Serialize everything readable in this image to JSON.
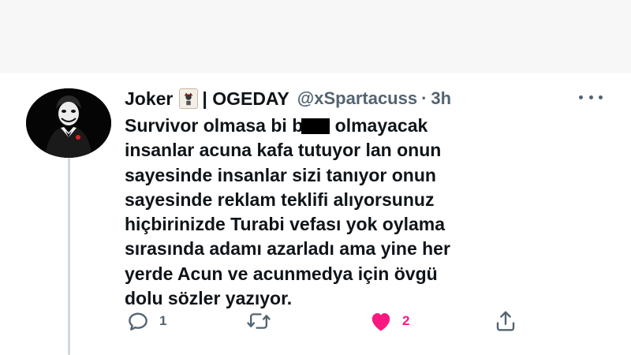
{
  "tweet": {
    "display_name": "Joker",
    "name_suffix": "| OGEDAY",
    "handle": "@xSpartacuss",
    "separator": "·",
    "time": "3h",
    "body_lines": [
      {
        "before": "Survivor olmasa bi b",
        "after": " olmayacak"
      },
      "insanlar acuna kafa tutuyor lan onun",
      "sayesinde insanlar sizi tanıyor onun",
      "sayesinde reklam teklifi alıyorsunuz",
      "hiçbirinizde Turabi vefası yok oylama",
      "sırasında adamı azarladı ama yine her",
      "yerde Acun ve acunmedya için övgü",
      "dolu sözler yazıyor."
    ]
  },
  "actions": {
    "reply": {
      "icon": "reply-icon",
      "count": "1"
    },
    "retweet": {
      "icon": "retweet-icon",
      "count": ""
    },
    "like": {
      "icon": "heart-icon",
      "count": "2",
      "color": "#f91880"
    },
    "share": {
      "icon": "share-icon"
    }
  },
  "colors": {
    "text": "#0f1419",
    "muted": "#536471",
    "like": "#f91880",
    "thread_line": "#cfd9de"
  }
}
